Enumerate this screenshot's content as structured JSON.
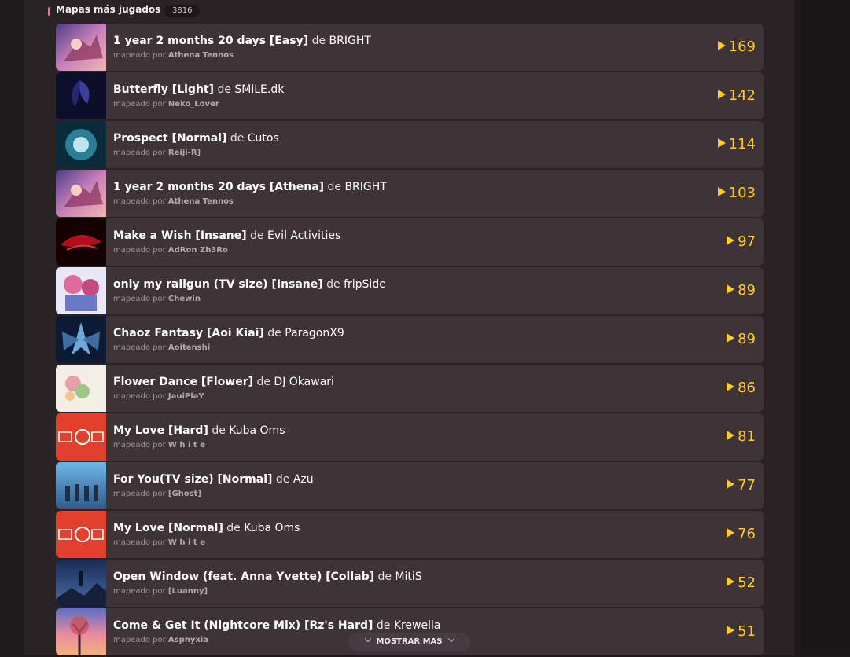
{
  "section": {
    "title": "Mapas más jugados",
    "count": "3816",
    "accent_color": "#ff66aa",
    "play_color": "#ffcc22"
  },
  "show_more": {
    "label": "MOSTRAR MÁS"
  },
  "maps": [
    {
      "title": "1 year 2 months 20 days [Easy]",
      "sep": "de",
      "artist": "BRIGHT",
      "mapper_prefix": "mapeado por",
      "mapper": "Athena Tennos",
      "plays": "169"
    },
    {
      "title": "Butterfly [Light]",
      "sep": "de",
      "artist": "SMiLE.dk",
      "mapper_prefix": "mapeado por",
      "mapper": "Neko_Lover",
      "plays": "142"
    },
    {
      "title": "Prospect [Normal]",
      "sep": "de",
      "artist": "Cutos",
      "mapper_prefix": "mapeado por",
      "mapper": "Reiji-R]",
      "plays": "114"
    },
    {
      "title": "1 year 2 months 20 days [Athena]",
      "sep": "de",
      "artist": "BRIGHT",
      "mapper_prefix": "mapeado por",
      "mapper": "Athena Tennos",
      "plays": "103"
    },
    {
      "title": "Make a Wish [Insane]",
      "sep": "de",
      "artist": "Evil Activities",
      "mapper_prefix": "mapeado por",
      "mapper": "AdRon Zh3Ro",
      "plays": "97"
    },
    {
      "title": "only my railgun (TV size) [Insane]",
      "sep": "de",
      "artist": "fripSide",
      "mapper_prefix": "mapeado por",
      "mapper": "Chewin",
      "plays": "89"
    },
    {
      "title": "Chaoz Fantasy [Aoi Kiai]",
      "sep": "de",
      "artist": "ParagonX9",
      "mapper_prefix": "mapeado por",
      "mapper": "Aoitenshi",
      "plays": "89"
    },
    {
      "title": "Flower Dance [Flower]",
      "sep": "de",
      "artist": "DJ Okawari",
      "mapper_prefix": "mapeado por",
      "mapper": "JauiPlaY",
      "plays": "86"
    },
    {
      "title": "My Love [Hard]",
      "sep": "de",
      "artist": "Kuba Oms",
      "mapper_prefix": "mapeado por",
      "mapper": "W h i t e",
      "plays": "81"
    },
    {
      "title": "For You(TV size) [Normal]",
      "sep": "de",
      "artist": "Azu",
      "mapper_prefix": "mapeado por",
      "mapper": "[Ghost]",
      "plays": "77"
    },
    {
      "title": "My Love [Normal]",
      "sep": "de",
      "artist": "Kuba Oms",
      "mapper_prefix": "mapeado por",
      "mapper": "W h i t e",
      "plays": "76"
    },
    {
      "title": "Open Window (feat. Anna Yvette) [Collab]",
      "sep": "de",
      "artist": "MitiS",
      "mapper_prefix": "mapeado por",
      "mapper": "[Luanny]",
      "plays": "52"
    },
    {
      "title": "Come & Get It (Nightcore Mix) [Rz's Hard]",
      "sep": "de",
      "artist": "Krewella",
      "mapper_prefix": "mapeado por",
      "mapper": "Asphyxia",
      "plays": "51"
    }
  ]
}
